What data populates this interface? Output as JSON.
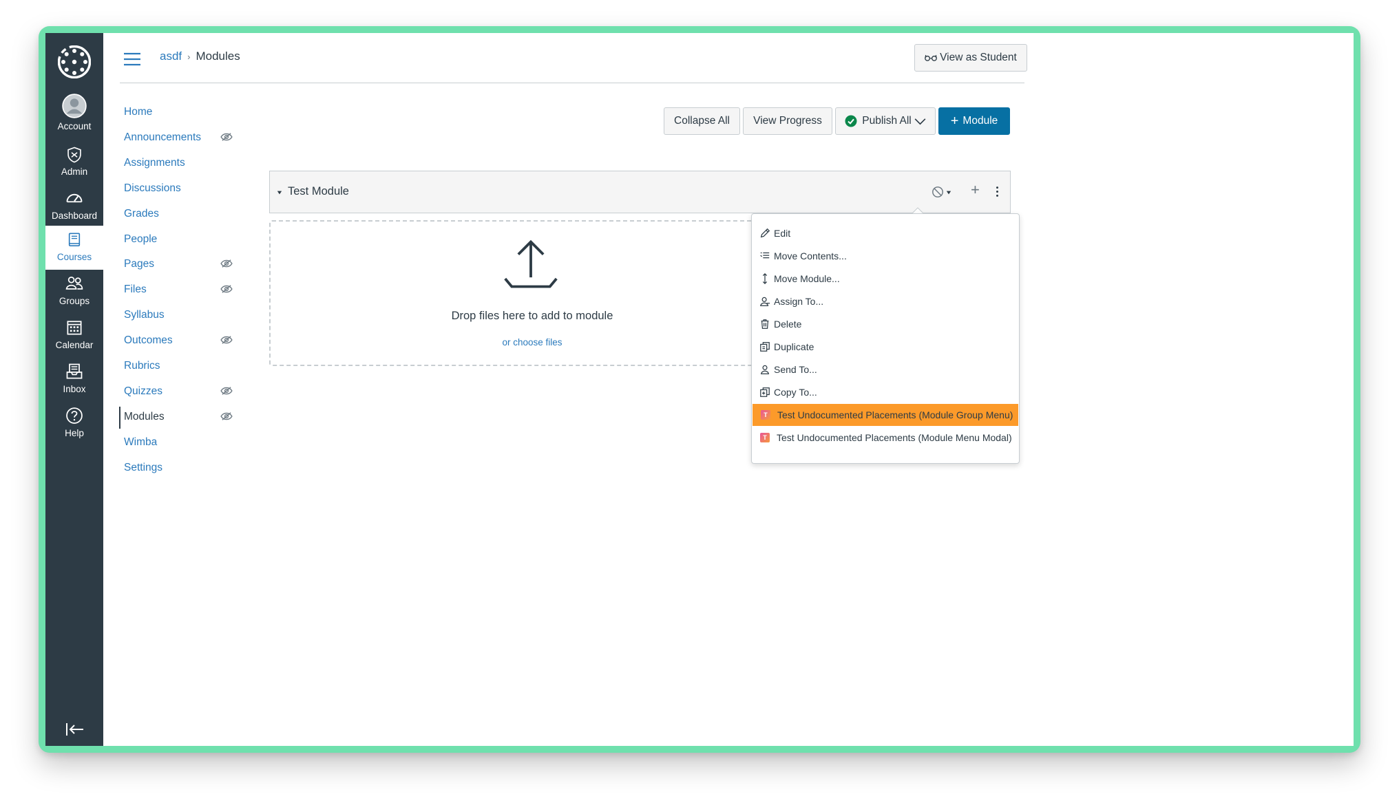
{
  "global_nav": {
    "items": [
      {
        "label": "Account",
        "icon": "account-icon"
      },
      {
        "label": "Admin",
        "icon": "admin-shield-icon"
      },
      {
        "label": "Dashboard",
        "icon": "dashboard-gauge-icon"
      },
      {
        "label": "Courses",
        "icon": "courses-book-icon",
        "active": true
      },
      {
        "label": "Groups",
        "icon": "groups-icon"
      },
      {
        "label": "Calendar",
        "icon": "calendar-icon"
      },
      {
        "label": "Inbox",
        "icon": "inbox-icon"
      },
      {
        "label": "Help",
        "icon": "help-icon"
      }
    ]
  },
  "header": {
    "breadcrumb_course": "asdf",
    "breadcrumb_sep": "›",
    "breadcrumb_current": "Modules",
    "view_as_student": "View as Student"
  },
  "course_nav": {
    "items": [
      {
        "label": "Home",
        "hidden": false
      },
      {
        "label": "Announcements",
        "hidden": true
      },
      {
        "label": "Assignments",
        "hidden": false
      },
      {
        "label": "Discussions",
        "hidden": false
      },
      {
        "label": "Grades",
        "hidden": false
      },
      {
        "label": "People",
        "hidden": false
      },
      {
        "label": "Pages",
        "hidden": true
      },
      {
        "label": "Files",
        "hidden": true
      },
      {
        "label": "Syllabus",
        "hidden": false
      },
      {
        "label": "Outcomes",
        "hidden": true
      },
      {
        "label": "Rubrics",
        "hidden": false
      },
      {
        "label": "Quizzes",
        "hidden": true
      },
      {
        "label": "Modules",
        "hidden": true,
        "active": true
      },
      {
        "label": "Wimba",
        "hidden": false
      },
      {
        "label": "Settings",
        "hidden": false
      }
    ]
  },
  "toolbar": {
    "collapse_all": "Collapse All",
    "view_progress": "View Progress",
    "publish_all": "Publish All",
    "add_module": "Module"
  },
  "module": {
    "title": "Test Module",
    "drop_text": "Drop files here to add to module",
    "choose_files": "or choose files"
  },
  "module_menu": {
    "items": [
      {
        "label": "Edit",
        "icon": "pencil-icon"
      },
      {
        "label": "Move Contents...",
        "icon": "move-contents-icon"
      },
      {
        "label": "Move Module...",
        "icon": "move-vertical-icon"
      },
      {
        "label": "Assign To...",
        "icon": "assign-user-icon"
      },
      {
        "label": "Delete",
        "icon": "trash-icon"
      },
      {
        "label": "Duplicate",
        "icon": "duplicate-icon"
      },
      {
        "label": "Send To...",
        "icon": "send-user-icon"
      },
      {
        "label": "Copy To...",
        "icon": "copy-icon"
      },
      {
        "label": "Test Undocumented Placements (Module Group Menu)",
        "icon": "tool-t-icon",
        "highlighted": true
      },
      {
        "label": "Test Undocumented Placements (Module Menu Modal)",
        "icon": "tool-t-icon"
      }
    ]
  },
  "colors": {
    "frame_accent": "#6fe0ad",
    "nav_bg": "#2d3b45",
    "link": "#2b7abc",
    "primary_button": "#0770a3",
    "menu_highlight": "#fc9a2a",
    "publish_check": "#0b874b"
  }
}
